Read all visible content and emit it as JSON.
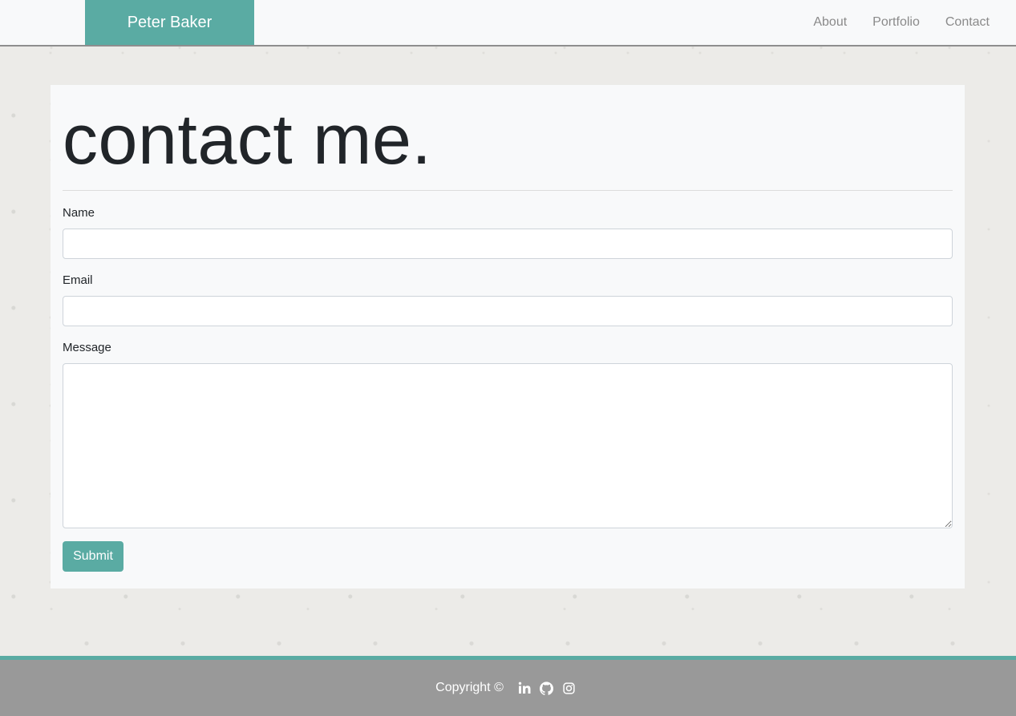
{
  "navbar": {
    "brand": "Peter Baker",
    "links": [
      "About",
      "Portfolio",
      "Contact"
    ]
  },
  "main": {
    "title": "contact me.",
    "form": {
      "name_label": "Name",
      "name_value": "",
      "email_label": "Email",
      "email_value": "",
      "message_label": "Message",
      "message_value": "",
      "submit_label": "Submit"
    }
  },
  "footer": {
    "copyright": "Copyright ©",
    "icons": [
      "linkedin-icon",
      "github-icon",
      "instagram-icon"
    ]
  },
  "colors": {
    "accent": "#5aaba3",
    "footer_bg": "#999999",
    "navbar_bg": "#f8f9fa",
    "card_bg": "#f8f9fa",
    "nav_link": "#8a8a8a"
  }
}
